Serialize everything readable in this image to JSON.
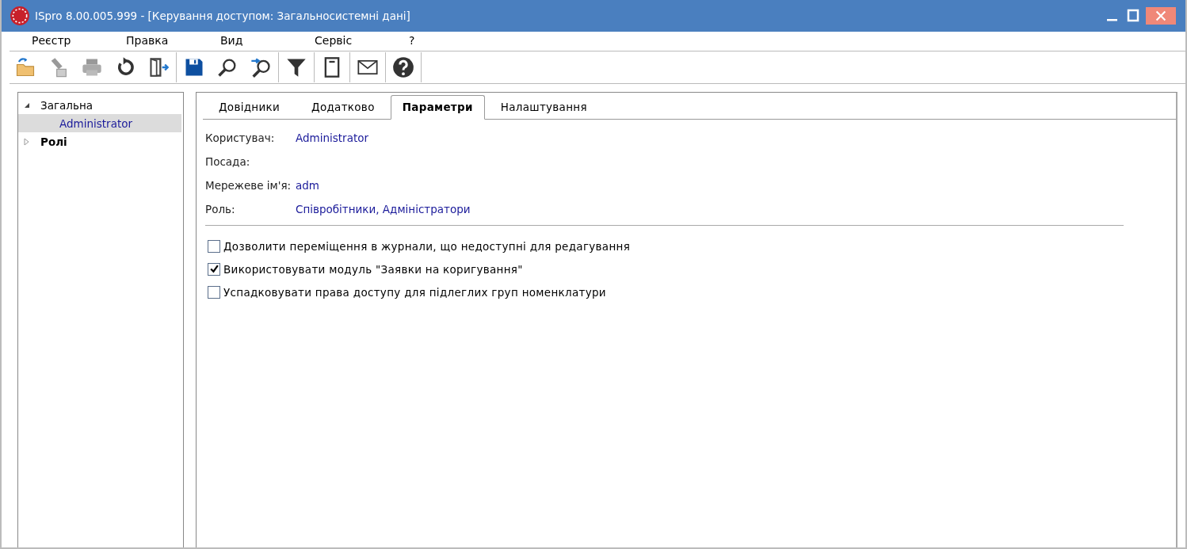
{
  "window": {
    "title": "ISpro 8.00.005.999 - [Керування доступом:  Загальносистемні дані]"
  },
  "menu": [
    "Реєстр",
    "Правка",
    "Вид",
    "Сервіс",
    "?"
  ],
  "tree": [
    {
      "label": "Загальна",
      "kind": "normal",
      "expanded": true,
      "selected": false,
      "children": [
        {
          "label": "Administrator",
          "kind": "normal",
          "selected": true
        }
      ]
    },
    {
      "label": "Ролі",
      "kind": "bold",
      "expanded": false,
      "selected": false
    }
  ],
  "tabs": [
    {
      "label": "Довідники",
      "selected": false
    },
    {
      "label": "Додатково",
      "selected": false
    },
    {
      "label": "Параметри",
      "selected": true
    },
    {
      "label": "Налаштування",
      "selected": false
    }
  ],
  "fields": [
    {
      "label": "Користувач:",
      "value": "Administrator"
    },
    {
      "label": "Посада:"
    },
    {
      "label": "Мережеве ім'я:",
      "value": "adm"
    },
    {
      "label": "Роль:",
      "value": "Співробітники, Адміністратори"
    }
  ],
  "options": [
    {
      "label": "Дозволити переміщення в журнали, що недоступні для редагування",
      "checked": false
    },
    {
      "label": "Використовувати модуль \"Заявки на коригування\"",
      "checked": true
    },
    {
      "label": "Успадковувати права доступу для підлеглих груп номенклатури",
      "checked": false
    }
  ]
}
